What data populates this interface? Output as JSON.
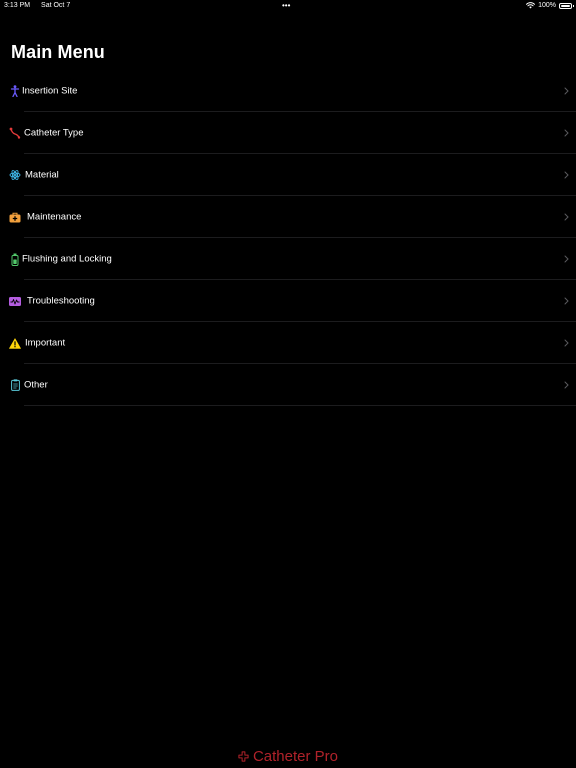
{
  "status_bar": {
    "time": "3:13 PM",
    "date": "Sat Oct 7",
    "dots": "•••",
    "battery": "100%"
  },
  "header": {
    "title": "Main Menu"
  },
  "menu": {
    "items": [
      {
        "label": "Insertion Site",
        "icon": "person-figure-icon",
        "color": "#6b5bff"
      },
      {
        "label": "Catheter Type",
        "icon": "catheter-tube-icon",
        "color": "#e23a3a"
      },
      {
        "label": "Material",
        "icon": "atom-icon",
        "color": "#3fb6e8"
      },
      {
        "label": "Maintenance",
        "icon": "medical-bag-icon",
        "color": "#f2a03d"
      },
      {
        "label": "Flushing and Locking",
        "icon": "syringe-vial-icon",
        "color": "#52c96b"
      },
      {
        "label": "Troubleshooting",
        "icon": "waveform-icon",
        "color": "#b45de0"
      },
      {
        "label": "Important",
        "icon": "warning-triangle-icon",
        "color": "#ffd60a"
      },
      {
        "label": "Other",
        "icon": "clipboard-icon",
        "color": "#5ac8d8"
      }
    ]
  },
  "footer": {
    "brand": "Catheter Pro",
    "color": "#b0222a"
  }
}
